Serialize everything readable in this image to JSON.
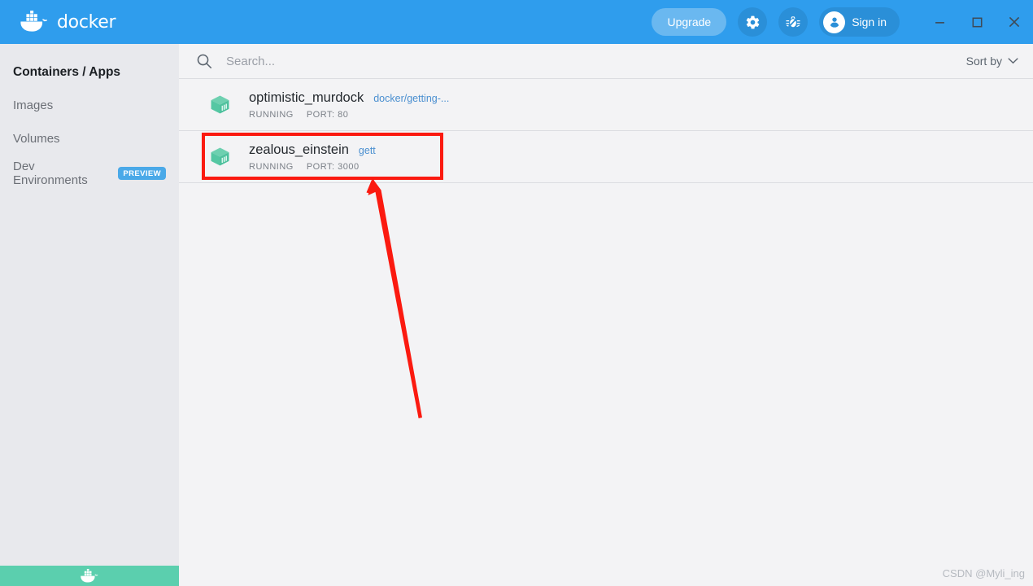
{
  "titlebar": {
    "brand_text": "docker",
    "logo_icon": "docker-whale-logo",
    "upgrade_label": "Upgrade",
    "settings_icon": "gear-icon",
    "troubleshoot_icon": "bug-icon",
    "signin_label": "Sign in",
    "account_icon": "user-avatar-icon",
    "minimize_icon": "minimize-icon",
    "maximize_icon": "maximize-icon",
    "close_icon": "close-icon",
    "background_color": "#2f9ded"
  },
  "sidebar": {
    "items": [
      {
        "label": "Containers / Apps",
        "active": true,
        "badge": null
      },
      {
        "label": "Images",
        "active": false,
        "badge": null
      },
      {
        "label": "Volumes",
        "active": false,
        "badge": null
      },
      {
        "label": "Dev Environments",
        "active": false,
        "badge": "PREVIEW"
      }
    ],
    "background_color": "#e8e9ed"
  },
  "statusbar": {
    "icon": "docker-whale-icon",
    "color": "#5bcfae"
  },
  "search": {
    "icon": "search-icon",
    "placeholder": "Search...",
    "value": ""
  },
  "sort": {
    "label": "Sort by",
    "chevron_icon": "chevron-down-icon"
  },
  "containers": [
    {
      "icon": "container-cube-icon",
      "name": "optimistic_murdock",
      "image": "docker/getting-...",
      "state": "RUNNING",
      "port": "PORT: 80",
      "highlighted": false
    },
    {
      "icon": "container-cube-icon",
      "name": "zealous_einstein",
      "image": "gett",
      "state": "RUNNING",
      "port": "PORT: 3000",
      "highlighted": true
    }
  ],
  "annotation": {
    "highlight_color": "#fb1a10",
    "box_target": "zealous_einstein",
    "arrow_icon": "red-arrow-up-icon"
  },
  "watermark": {
    "text": "CSDN @Myli_ing"
  }
}
